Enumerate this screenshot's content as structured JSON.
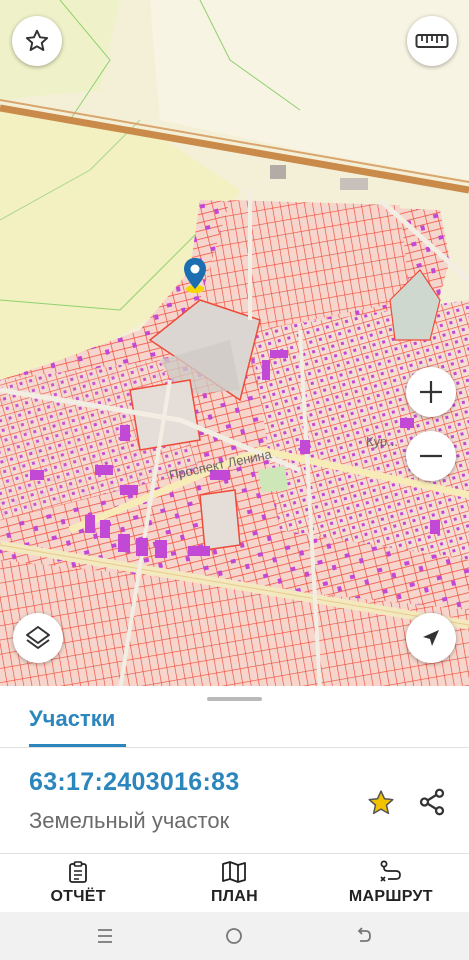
{
  "map": {
    "street_label": "Проспект Ленина",
    "district_label": "Кур..."
  },
  "sheet": {
    "tab_label": "Участки",
    "parcel": {
      "cadastral_number": "63:17:2403016:83",
      "type": "Земельный участок"
    }
  },
  "actions": [
    {
      "label": "ОТЧЁТ",
      "icon": "report-icon"
    },
    {
      "label": "ПЛАН",
      "icon": "map-plan-icon"
    },
    {
      "label": "МАРШРУТ",
      "icon": "route-icon"
    }
  ],
  "colors": {
    "accent": "#2a86bd",
    "parcel_outline": "#ef4b3a",
    "building": "#c249d6",
    "star": "#f2c200",
    "map_background": "#f3efdc"
  }
}
